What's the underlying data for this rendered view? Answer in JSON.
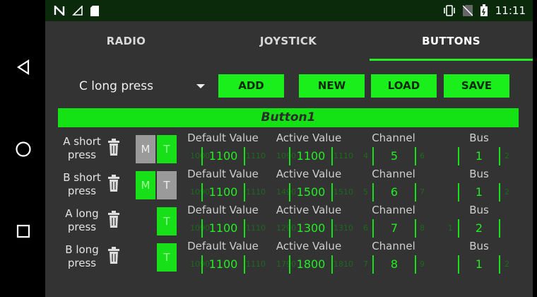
{
  "status": {
    "time": "11:11"
  },
  "tabs": [
    {
      "label": "RADIO",
      "active": false
    },
    {
      "label": "JOYSTICK",
      "active": false
    },
    {
      "label": "BUTTONS",
      "active": true
    }
  ],
  "toolbar": {
    "selected": "C long press",
    "add": "ADD",
    "new": "NEW",
    "load": "LOAD",
    "save": "SAVE"
  },
  "section_title": "Button1",
  "field_labels": {
    "default": "Default Value",
    "active": "Active Value",
    "channel": "Channel",
    "bus": "Bus"
  },
  "rows": [
    {
      "label": "A short press",
      "m": "M",
      "t": "T",
      "m_on": false,
      "t_on": true,
      "default": "1100",
      "active": "1100",
      "channel": "5",
      "bus": "1",
      "ghost": {
        "dl": "1000",
        "dr": "1110",
        "al": "1090",
        "ar": "1110",
        "cl": "4",
        "cr": "6",
        "bl": "",
        "br": "2"
      }
    },
    {
      "label": "B short press",
      "m": "M",
      "t": "T",
      "m_on": true,
      "t_on": false,
      "default": "1100",
      "active": "1500",
      "channel": "6",
      "bus": "1",
      "ghost": {
        "dl": "1090",
        "dr": "1110",
        "al": "1490",
        "ar": "1510",
        "cl": "5",
        "cr": "7",
        "bl": "",
        "br": "2"
      }
    },
    {
      "label": "A long press",
      "m": "",
      "t": "T",
      "m_on": false,
      "t_on": true,
      "default": "1100",
      "active": "1300",
      "channel": "7",
      "bus": "2",
      "ghost": {
        "dl": "1090",
        "dr": "1110",
        "al": "1290",
        "ar": "1310",
        "cl": "6",
        "cr": "8",
        "bl": "1",
        "br": ""
      }
    },
    {
      "label": "B long press",
      "m": "",
      "t": "T",
      "m_on": false,
      "t_on": true,
      "default": "1100",
      "active": "1800",
      "channel": "8",
      "bus": "1",
      "ghost": {
        "dl": "1090",
        "dr": "1110",
        "al": "1790",
        "ar": "1810",
        "cl": "7",
        "cr": "9",
        "bl": "",
        "br": "2"
      }
    }
  ]
}
